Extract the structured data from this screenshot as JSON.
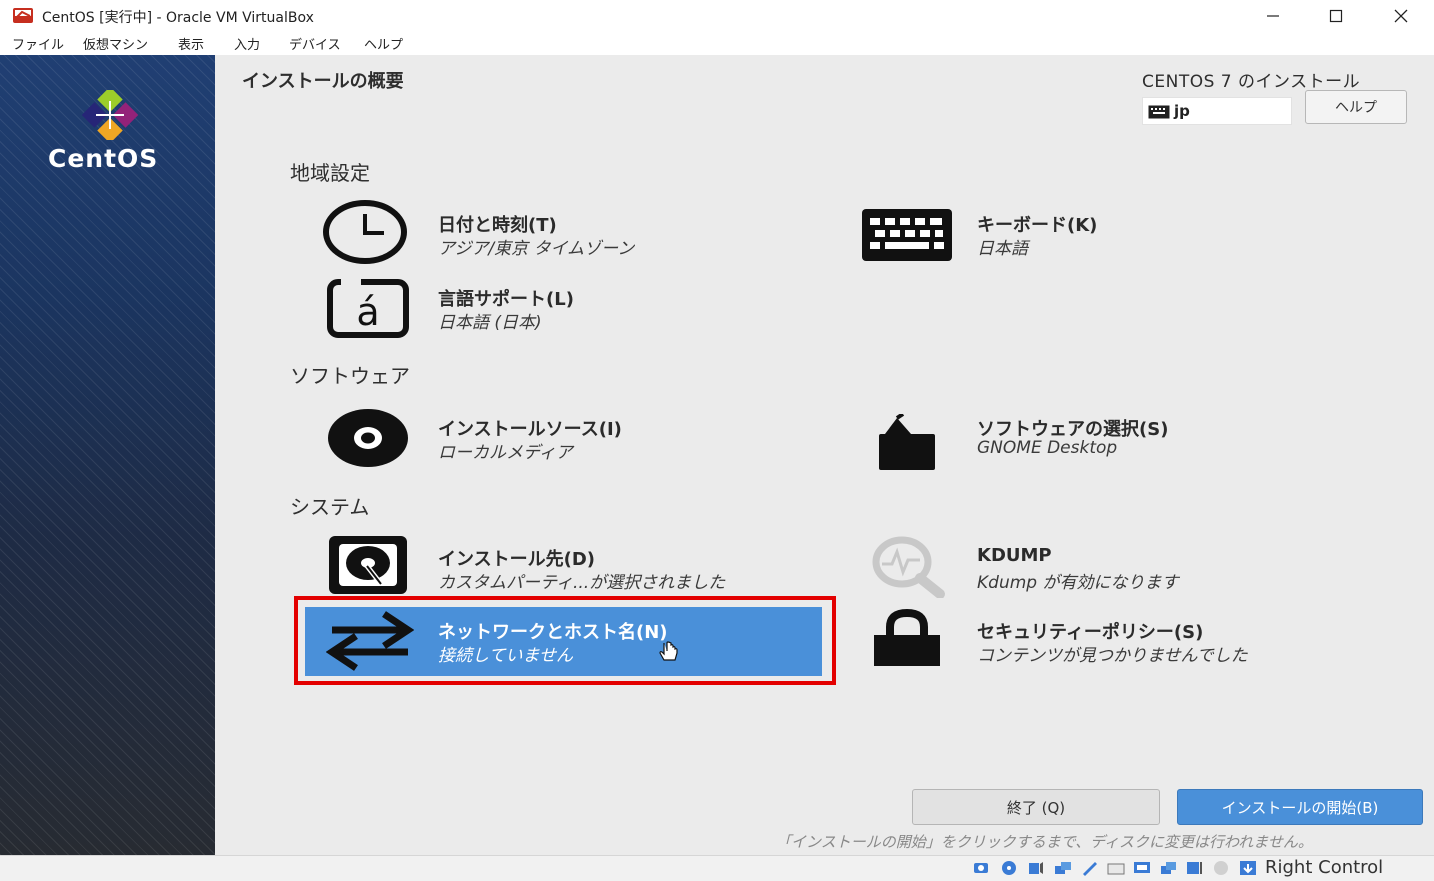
{
  "window": {
    "title": "CentOS [実行中] - Oracle VM VirtualBox"
  },
  "menu": [
    "ファイル",
    "仮想マシン",
    "表示",
    "入力",
    "デバイス",
    "ヘルプ"
  ],
  "sidebar": {
    "brand": "CentOS"
  },
  "header": {
    "page_title": "インストールの概要",
    "product_title": "CENTOS 7 のインストール",
    "keyboard_layout": "jp",
    "help_label": "ヘルプ"
  },
  "sections": {
    "localization": "地域設定",
    "software": "ソフトウェア",
    "system": "システム"
  },
  "spokes": {
    "datetime": {
      "title": "日付と時刻(T)",
      "status": "アジア/東京 タイムゾーン",
      "icon": "clock-icon"
    },
    "keyboard": {
      "title": "キーボード(K)",
      "status": "日本語",
      "icon": "keyboard-icon"
    },
    "language": {
      "title": "言語サポート(L)",
      "status": "日本語 (日本)",
      "icon": "language-icon"
    },
    "source": {
      "title": "インストールソース(I)",
      "status": "ローカルメディア",
      "icon": "disc-icon"
    },
    "software": {
      "title": "ソフトウェアの選択(S)",
      "status": "GNOME Desktop",
      "icon": "package-icon"
    },
    "destination": {
      "title": "インストール先(D)",
      "status": "カスタムパーティ...が選択されました",
      "icon": "disk-icon"
    },
    "kdump": {
      "title": "KDUMP",
      "status": "Kdump が有効になります",
      "icon": "search-icon"
    },
    "network": {
      "title": "ネットワークとホスト名(N)",
      "status": "接続していません",
      "icon": "network-arrows-icon",
      "selected": true
    },
    "security": {
      "title": "セキュリティーポリシー(S)",
      "status": "コンテンツが見つかりませんでした",
      "icon": "lock-icon"
    }
  },
  "footer": {
    "quit_label": "終了 (Q)",
    "begin_label": "インストールの開始(B)",
    "note": "「インストールの開始」をクリックするまで、ディスクに変更は行われません。"
  },
  "statusbar": {
    "host_key": "Right Control"
  },
  "colors": {
    "selected": "#4a90d9",
    "highlight_border": "#e30000"
  }
}
